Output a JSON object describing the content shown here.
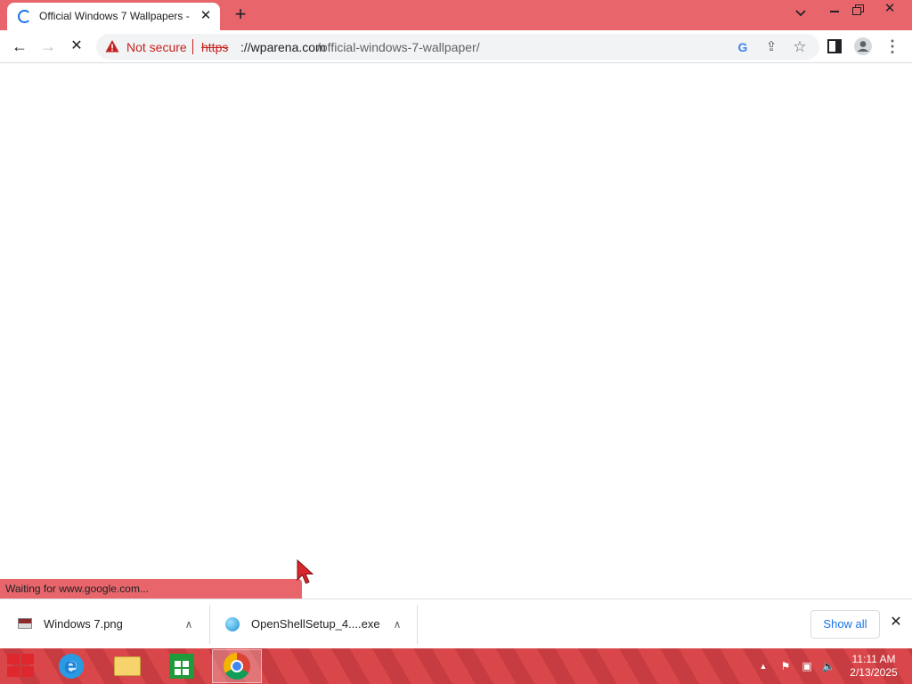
{
  "browser": {
    "tab": {
      "title": "Official Windows 7 Wallpapers -",
      "close_glyph": "✕",
      "loading_icon": "loading-spinner-icon"
    },
    "new_tab_glyph": "+",
    "window_controls": {
      "tab_search_glyph": "⌄",
      "close_glyph": "✕"
    },
    "toolbar": {
      "back_glyph": "←",
      "forward_glyph": "→",
      "stop_glyph": "✕",
      "security_label": "Not secure",
      "url_scheme": "https",
      "url_host": "://wparena.com",
      "url_path": "/official-windows-7-wallpaper/",
      "google_glyph": "G",
      "share_glyph": "⇪",
      "star_glyph": "☆",
      "menu_glyph": "⋮",
      "warning_color": "#c5221f"
    },
    "status_text": "Waiting for www.google.com..."
  },
  "downloads": {
    "items": [
      {
        "name": "Windows 7.png",
        "icon": "image-file-icon",
        "chevron": "∧"
      },
      {
        "name": "OpenShellSetup_4....exe",
        "icon": "installer-file-icon",
        "chevron": "∧"
      }
    ],
    "show_all_label": "Show all",
    "close_glyph": "✕"
  },
  "taskbar": {
    "accent": "#d9474b",
    "apps": [
      "internet-explorer-icon",
      "file-explorer-icon",
      "store-icon",
      "chrome-icon"
    ],
    "tray": {
      "chevron_glyph": "▲",
      "flag_glyph": "⚑",
      "network_glyph": "▣",
      "volume_glyph": "🔈"
    },
    "clock": {
      "time": "11:11 AM",
      "date": "2/13/2025"
    }
  }
}
